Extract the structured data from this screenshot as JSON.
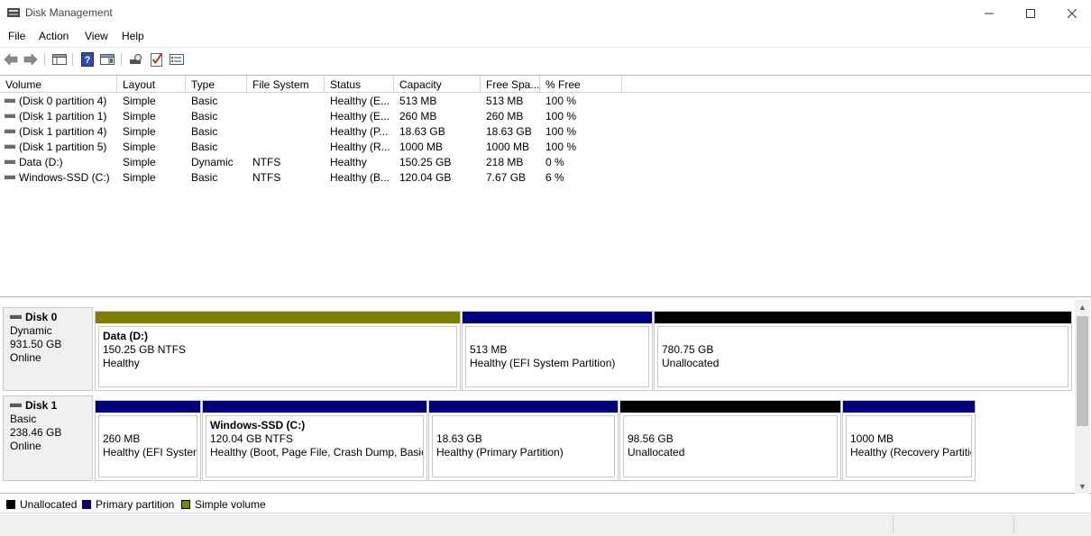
{
  "window": {
    "title": "Disk Management"
  },
  "menu": [
    "File",
    "Action",
    "View",
    "Help"
  ],
  "volume_list": {
    "columns": [
      "Volume",
      "Layout",
      "Type",
      "File System",
      "Status",
      "Capacity",
      "Free Spa...",
      "% Free"
    ],
    "rows": [
      {
        "volume": "(Disk 0 partition 4)",
        "layout": "Simple",
        "type": "Basic",
        "fs": "",
        "status": "Healthy (E...",
        "capacity": "513 MB",
        "free": "513 MB",
        "pct": "100 %"
      },
      {
        "volume": "(Disk 1 partition 1)",
        "layout": "Simple",
        "type": "Basic",
        "fs": "",
        "status": "Healthy (E...",
        "capacity": "260 MB",
        "free": "260 MB",
        "pct": "100 %"
      },
      {
        "volume": "(Disk 1 partition 4)",
        "layout": "Simple",
        "type": "Basic",
        "fs": "",
        "status": "Healthy (P...",
        "capacity": "18.63 GB",
        "free": "18.63 GB",
        "pct": "100 %"
      },
      {
        "volume": "(Disk 1 partition 5)",
        "layout": "Simple",
        "type": "Basic",
        "fs": "",
        "status": "Healthy (R...",
        "capacity": "1000 MB",
        "free": "1000 MB",
        "pct": "100 %"
      },
      {
        "volume": "Data (D:)",
        "layout": "Simple",
        "type": "Dynamic",
        "fs": "NTFS",
        "status": "Healthy",
        "capacity": "150.25 GB",
        "free": "218 MB",
        "pct": "0 %"
      },
      {
        "volume": "Windows-SSD (C:)",
        "layout": "Simple",
        "type": "Basic",
        "fs": "NTFS",
        "status": "Healthy (B...",
        "capacity": "120.04 GB",
        "free": "7.67 GB",
        "pct": "6 %"
      }
    ]
  },
  "disks": [
    {
      "name": "Disk 0",
      "kind": "Dynamic",
      "size": "931.50 GB",
      "state": "Online",
      "partitions": [
        {
          "name": "Data  (D:)",
          "size": "150.25 GB NTFS",
          "status": "Healthy",
          "kind": "simple"
        },
        {
          "name": "",
          "size": "513 MB",
          "status": "Healthy (EFI System Partition)",
          "kind": "primary"
        },
        {
          "name": "",
          "size": "780.75 GB",
          "status": "Unallocated",
          "kind": "unallocated"
        }
      ]
    },
    {
      "name": "Disk 1",
      "kind": "Basic",
      "size": "238.46 GB",
      "state": "Online",
      "partitions": [
        {
          "name": "",
          "size": "260 MB",
          "status": "Healthy (EFI System",
          "kind": "primary"
        },
        {
          "name": "Windows-SSD  (C:)",
          "size": "120.04 GB NTFS",
          "status": "Healthy (Boot, Page File, Crash Dump, Basic",
          "kind": "primary"
        },
        {
          "name": "",
          "size": "18.63 GB",
          "status": "Healthy (Primary Partition)",
          "kind": "primary"
        },
        {
          "name": "",
          "size": "98.56 GB",
          "status": "Unallocated",
          "kind": "unallocated"
        },
        {
          "name": "",
          "size": "1000 MB",
          "status": "Healthy (Recovery Partitic",
          "kind": "primary"
        }
      ]
    }
  ],
  "legend": [
    "Unallocated",
    "Primary partition",
    "Simple volume"
  ],
  "colors": {
    "unallocated": "#000000",
    "primary": "#00007f",
    "simple": "#7f7f00"
  }
}
